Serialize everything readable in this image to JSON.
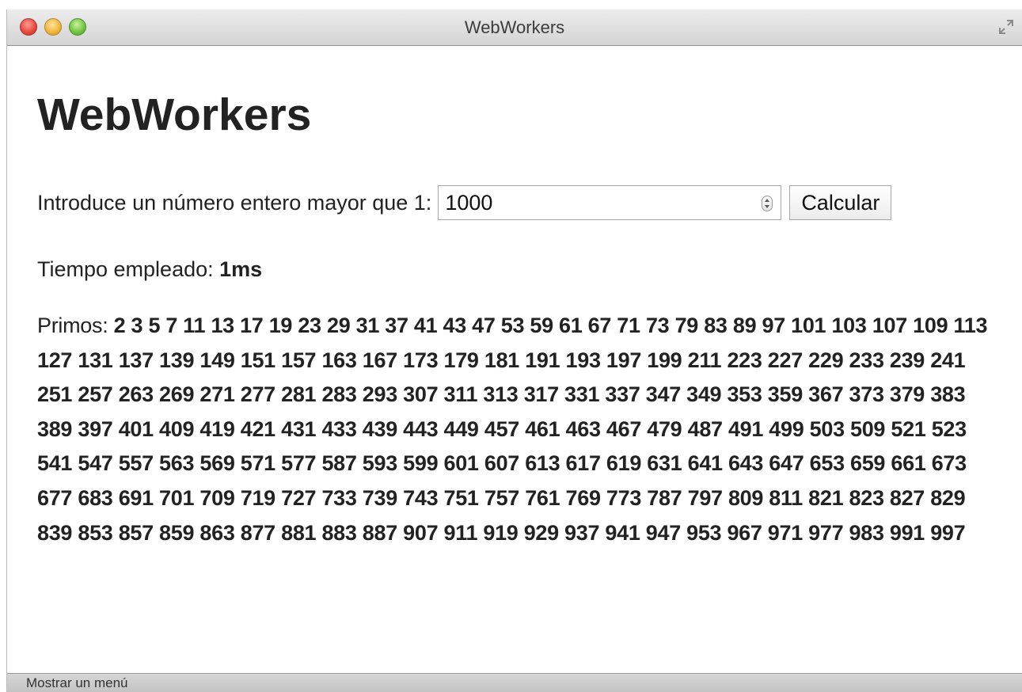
{
  "window": {
    "title": "WebWorkers"
  },
  "page": {
    "heading": "WebWorkers",
    "input_label": "Introduce un número entero mayor que 1:",
    "input_value": "1000",
    "button_label": "Calcular",
    "time_label": "Tiempo empleado:",
    "time_value": "1ms",
    "primes_label": "Primos:",
    "primes_value": "2 3 5 7 11 13 17 19 23 29 31 37 41 43 47 53 59 61 67 71 73 79 83 89 97 101 103 107 109 113 127 131 137 139 149 151 157 163 167 173 179 181 191 193 197 199 211 223 227 229 233 239 241 251 257 263 269 271 277 281 283 293 307 311 313 317 331 337 347 349 353 359 367 373 379 383 389 397 401 409 419 421 431 433 439 443 449 457 461 463 467 479 487 491 499 503 509 521 523 541 547 557 563 569 571 577 587 593 599 601 607 613 617 619 631 641 643 647 653 659 661 673 677 683 691 701 709 719 727 733 739 743 751 757 761 769 773 787 797 809 811 821 823 827 829 839 853 857 859 863 877 881 883 887 907 911 919 929 937 941 947 953 967 971 977 983 991 997"
  },
  "statusbar": {
    "text": "Mostrar un menú"
  },
  "colors": {
    "close": "#e5453a",
    "minimize": "#efb43a",
    "zoom": "#6ec33e",
    "text": "#222222"
  },
  "icons": {
    "close": "close-icon",
    "minimize": "minimize-icon",
    "zoom": "zoom-icon",
    "fullscreen": "fullscreen-icon",
    "spinner": "stepper-arrows-icon"
  }
}
